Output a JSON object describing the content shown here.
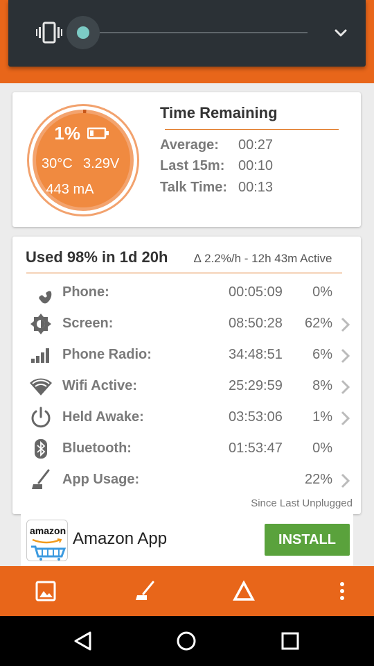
{
  "volume_panel": {
    "level": 0.0
  },
  "battery": {
    "percent": "1%",
    "temperature": "30°C",
    "voltage": "3.29V",
    "current": "443 mA",
    "gauge_fill": 0.01
  },
  "time_remaining": {
    "title": "Time Remaining",
    "rows": [
      {
        "label": "Average:",
        "value": "00:27"
      },
      {
        "label": "Last 15m:",
        "value": "00:10"
      },
      {
        "label": "Talk Time:",
        "value": "00:13"
      }
    ]
  },
  "usage": {
    "title": "Used 98% in 1d 20h",
    "rate": "∆ 2.2%/h - 12h 43m Active",
    "rows": [
      {
        "icon": "phone-icon",
        "label": "Phone:",
        "time": "00:05:09",
        "pct": "0%",
        "chevron": false
      },
      {
        "icon": "screen-brightness-icon",
        "label": "Screen:",
        "time": "08:50:28",
        "pct": "62%",
        "chevron": true
      },
      {
        "icon": "signal-bars-icon",
        "label": "Phone Radio:",
        "time": "34:48:51",
        "pct": "6%",
        "chevron": true
      },
      {
        "icon": "wifi-icon",
        "label": "Wifi Active:",
        "time": "25:29:59",
        "pct": "8%",
        "chevron": true
      },
      {
        "icon": "power-icon",
        "label": "Held Awake:",
        "time": "03:53:06",
        "pct": "1%",
        "chevron": true
      },
      {
        "icon": "bluetooth-icon",
        "label": "Bluetooth:",
        "time": "01:53:47",
        "pct": "0%",
        "chevron": false
      },
      {
        "icon": "broom-icon",
        "label": "App Usage:",
        "time": "",
        "pct": "22%",
        "chevron": true
      }
    ],
    "since_note": "Since Last Unplugged"
  },
  "ad": {
    "logo_text": "amazon",
    "title": "Amazon App",
    "install_label": "INSTALL"
  },
  "bottom_bar": {
    "icons": [
      "image-icon",
      "broom-icon",
      "delta-icon",
      "more-vert-icon"
    ]
  },
  "nav_bar": {
    "icons": [
      "back-icon",
      "home-icon",
      "recents-icon"
    ]
  },
  "colors": {
    "accent": "#e8661a",
    "panel": "#2b3136",
    "slider_thumb": "#7ccbc5",
    "install": "#5aa23c"
  }
}
